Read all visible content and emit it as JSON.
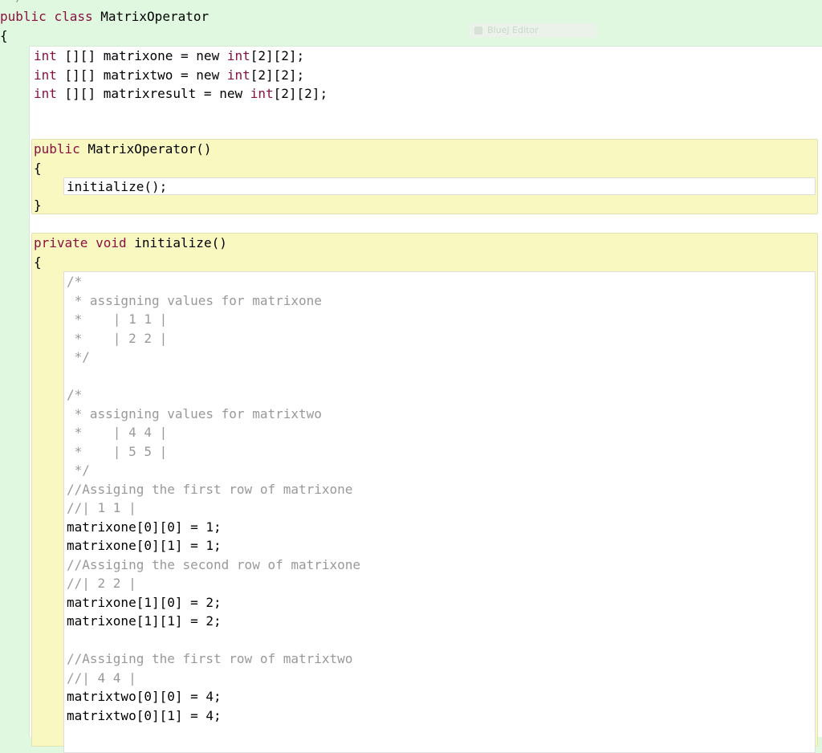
{
  "header": {
    "comment_end": " */",
    "class_kw1": "public",
    "class_kw2": "class",
    "class_name": "MatrixOperator",
    "open_brace": "{",
    "tooltip": "BlueJ Editor"
  },
  "fields": [
    {
      "type": "int",
      "rest1": " [][] matrixone = new ",
      "type2": "int",
      "rest2": "[2][2];"
    },
    {
      "type": "int",
      "rest1": " [][] matrixtwo = new ",
      "type2": "int",
      "rest2": "[2][2];"
    },
    {
      "type": "int",
      "rest1": " [][] matrixresult = new ",
      "type2": "int",
      "rest2": "[2][2];"
    }
  ],
  "constructor": {
    "kw": "public",
    "name": " MatrixOperator()",
    "open": "{",
    "body": "initialize();",
    "close": "}"
  },
  "initialize": {
    "kw1": "private",
    "kw2": "void",
    "name": " initialize()",
    "open": "{",
    "lines": [
      {
        "kind": "cm",
        "text": "/*"
      },
      {
        "kind": "cm",
        "text": " * assigning values for matrixone"
      },
      {
        "kind": "cm",
        "text": " *    | 1 1 |"
      },
      {
        "kind": "cm",
        "text": " *    | 2 2 |"
      },
      {
        "kind": "cm",
        "text": " */"
      },
      {
        "kind": "blank",
        "text": ""
      },
      {
        "kind": "cm",
        "text": "/*"
      },
      {
        "kind": "cm",
        "text": " * assigning values for matrixtwo"
      },
      {
        "kind": "cm",
        "text": " *    | 4 4 |"
      },
      {
        "kind": "cm",
        "text": " *    | 5 5 |"
      },
      {
        "kind": "cm",
        "text": " */"
      },
      {
        "kind": "cm",
        "text": "//Assiging the first row of matrixone"
      },
      {
        "kind": "cm",
        "text": "//| 1 1 |"
      },
      {
        "kind": "code",
        "text": "matrixone[0][0] = 1;"
      },
      {
        "kind": "code",
        "text": "matrixone[0][1] = 1;"
      },
      {
        "kind": "cm",
        "text": "//Assiging the second row of matrixone"
      },
      {
        "kind": "cm",
        "text": "//| 2 2 |"
      },
      {
        "kind": "code",
        "text": "matrixone[1][0] = 2;"
      },
      {
        "kind": "code",
        "text": "matrixone[1][1] = 2;"
      },
      {
        "kind": "blank",
        "text": ""
      },
      {
        "kind": "cm",
        "text": "//Assiging the first row of matrixtwo"
      },
      {
        "kind": "cm",
        "text": "//| 4 4 |"
      },
      {
        "kind": "code",
        "text": "matrixtwo[0][0] = 4;"
      },
      {
        "kind": "code",
        "text": "matrixtwo[0][1] = 4;"
      }
    ]
  },
  "colors": {
    "keyword": "#8b1040",
    "comment": "#999999",
    "class_bg": "#e0f8e0",
    "method_bg": "#f8f8c0",
    "body_bg": "#ffffff"
  }
}
